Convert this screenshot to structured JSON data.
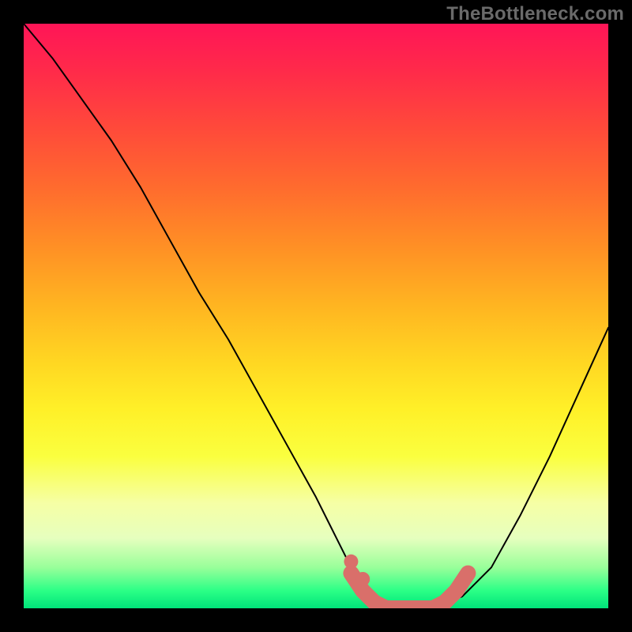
{
  "watermark": "TheBottleneck.com",
  "chart_data": {
    "type": "line",
    "title": "",
    "xlabel": "",
    "ylabel": "",
    "xlim": [
      0,
      100
    ],
    "ylim": [
      0,
      100
    ],
    "grid": false,
    "series": [
      {
        "name": "curve",
        "x": [
          0,
          5,
          10,
          15,
          20,
          25,
          30,
          35,
          40,
          45,
          50,
          52,
          54,
          56,
          58,
          60,
          62,
          64,
          66,
          68,
          70,
          72,
          75,
          80,
          85,
          90,
          95,
          100
        ],
        "y": [
          100,
          94,
          87,
          80,
          72,
          63,
          54,
          46,
          37,
          28,
          19,
          15,
          11,
          7,
          4,
          2,
          1,
          0,
          0,
          0,
          0,
          1,
          2,
          7,
          16,
          26,
          37,
          48
        ],
        "stroke": "#000000",
        "stroke_width": 2
      }
    ],
    "markers": [
      {
        "name": "marker-run",
        "style": "thick",
        "color": "#d96f6a",
        "x": [
          56,
          58,
          60,
          62,
          64,
          66,
          68,
          70,
          72,
          74,
          76
        ],
        "y": [
          6,
          3,
          1,
          0,
          0,
          0,
          0,
          0,
          1,
          3,
          6
        ]
      }
    ],
    "gradient_stops": [
      {
        "pos": 0.0,
        "color": "#ff1557"
      },
      {
        "pos": 0.18,
        "color": "#ff4a3a"
      },
      {
        "pos": 0.38,
        "color": "#ff8f25"
      },
      {
        "pos": 0.58,
        "color": "#ffd722"
      },
      {
        "pos": 0.74,
        "color": "#faff3f"
      },
      {
        "pos": 0.88,
        "color": "#e6ffbe"
      },
      {
        "pos": 1.0,
        "color": "#00e47a"
      }
    ]
  }
}
